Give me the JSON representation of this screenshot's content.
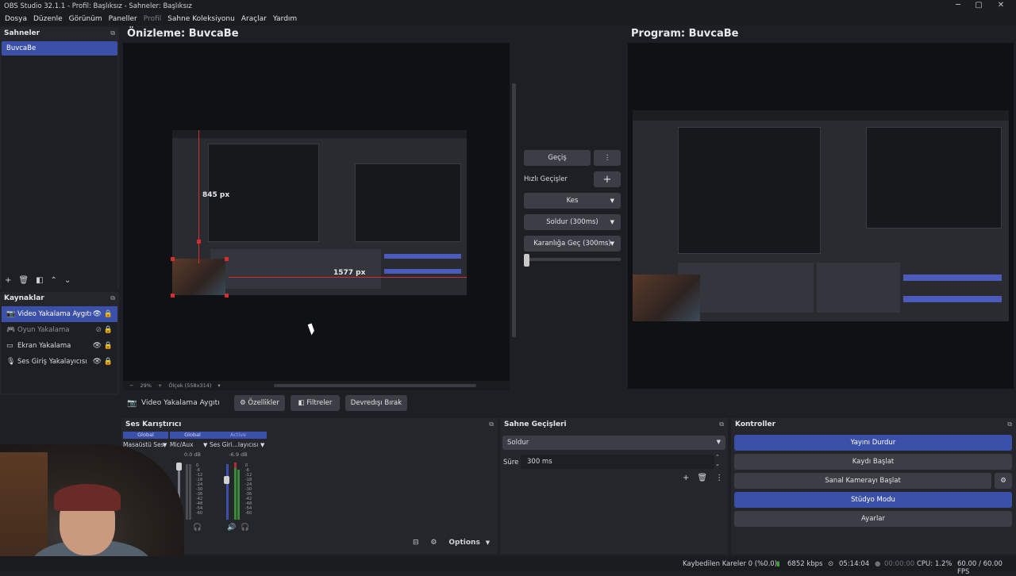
{
  "window": {
    "title": "OBS Studio 32.1.1 - Profil: Başlıksız - Sahneler: Başlıksız",
    "minimize": "─",
    "maximize": "▢",
    "close": "✕"
  },
  "menu": [
    "Dosya",
    "Düzenle",
    "Görünüm",
    "Paneller",
    "Profil",
    "Sahne Koleksiyonu",
    "Araçlar",
    "Yardım"
  ],
  "scenes": {
    "title": "Sahneler",
    "items": [
      "BuvcaBe"
    ]
  },
  "sources": {
    "title": "Kaynaklar",
    "items": [
      {
        "label": "Video Yakalama Aygıtı",
        "icon": "camera-icon",
        "selected": true
      },
      {
        "label": "Oyun Yakalama",
        "icon": "gamepad-icon",
        "hidden": true
      },
      {
        "label": "Ekran Yakalama",
        "icon": "monitor-icon"
      },
      {
        "label": "Ses Giriş Yakalayıcısı",
        "icon": "mic-icon"
      }
    ]
  },
  "preview": {
    "label": "Önizleme: BuvcaBe",
    "measure_v": "845 px",
    "measure_h": "1577 px",
    "zoom": "29%",
    "scale": "Ölçek (558x314)"
  },
  "program": {
    "label": "Program: BuvcaBe"
  },
  "transition_controls": {
    "transition_button": "Geçiş",
    "quick_label": "Hızlı Geçişler",
    "options": [
      "Kes",
      "Soldur (300ms)",
      "Karanlığa Geç (300ms)"
    ]
  },
  "context_bar": {
    "source": "Video Yakalama Aygıtı",
    "properties": "Özellikler",
    "filters": "Filtreler",
    "disable": "Devredışı Bırak"
  },
  "mixer": {
    "title": "Ses Karıştırıcı",
    "channels": [
      {
        "head": "Global",
        "name": "Masaüstü Ses",
        "db": ""
      },
      {
        "head": "Global",
        "name": "Mic/Aux",
        "db": "0.0 dB"
      },
      {
        "head": "Active",
        "name": "Ses Giri...layıcısı",
        "db": "-6.9 dB"
      }
    ],
    "scale": [
      "0",
      "-6",
      "-12",
      "-18",
      "-24",
      "-30",
      "-36",
      "-42",
      "-48",
      "-54",
      "-60"
    ],
    "options": "Options"
  },
  "scene_transitions": {
    "title": "Sahne Geçişleri",
    "selected": "Soldur",
    "duration_label": "Süre",
    "duration": "300 ms"
  },
  "controls": {
    "title": "Kontroller",
    "stop_stream": "Yayını Durdur",
    "start_record": "Kaydı Başlat",
    "virtual_cam": "Sanal Kamerayı Başlat",
    "studio_mode": "Stüdyo Modu",
    "settings": "Ayarlar"
  },
  "status": {
    "dropped": "Kaybedilen Kareler 0 (%0.0)",
    "bitrate": "6852 kbps",
    "stream_time": "05:14:04",
    "record_time": "00:00:00",
    "cpu": "CPU: 1.2%",
    "fps": "60.00 / 60.00 FPS"
  },
  "colors": {
    "accent": "#3b50a8",
    "background": "#1e1f24"
  }
}
